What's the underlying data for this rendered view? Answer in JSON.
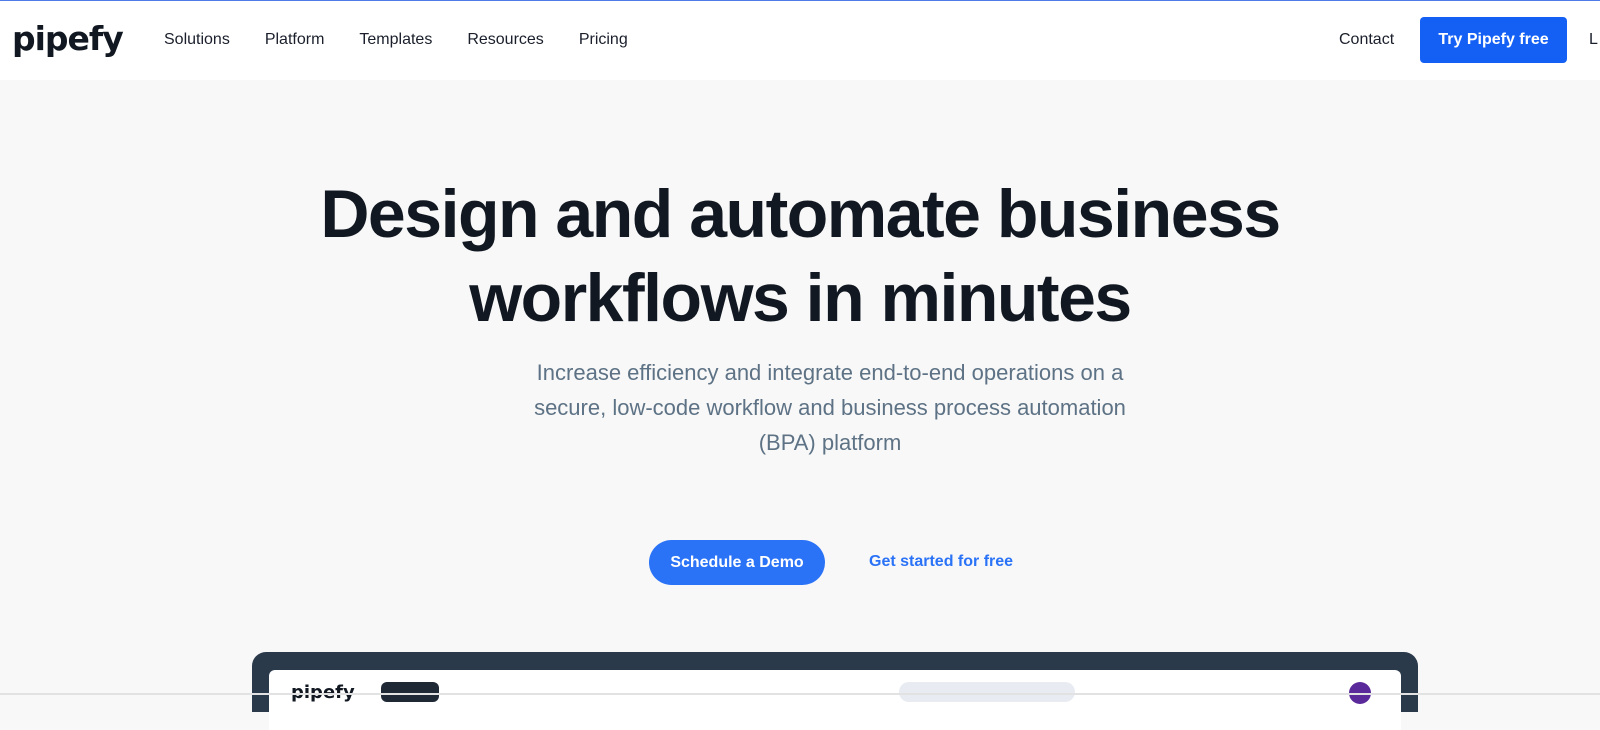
{
  "brand": {
    "logo": "pipefy"
  },
  "nav": {
    "items": [
      {
        "label": "Solutions"
      },
      {
        "label": "Platform"
      },
      {
        "label": "Templates"
      },
      {
        "label": "Resources"
      },
      {
        "label": "Pricing"
      }
    ],
    "contact": "Contact",
    "cta": "Try Pipefy free",
    "login_partial": "L"
  },
  "hero": {
    "title_line1": "Design and automate business",
    "title_line2": "workflows in minutes",
    "subtitle_line1": "Increase efficiency and integrate end-to-end operations on a",
    "subtitle_line2": "secure, low-code workflow and business process automation",
    "subtitle_line3": "(BPA) platform",
    "demo_button": "Schedule a Demo",
    "free_link": "Get started for free"
  },
  "preview": {
    "logo": "pipefy"
  },
  "colors": {
    "primary": "#1460f5",
    "accent": "#2a73f7",
    "heading": "#111821",
    "subtext": "#5d7285"
  }
}
